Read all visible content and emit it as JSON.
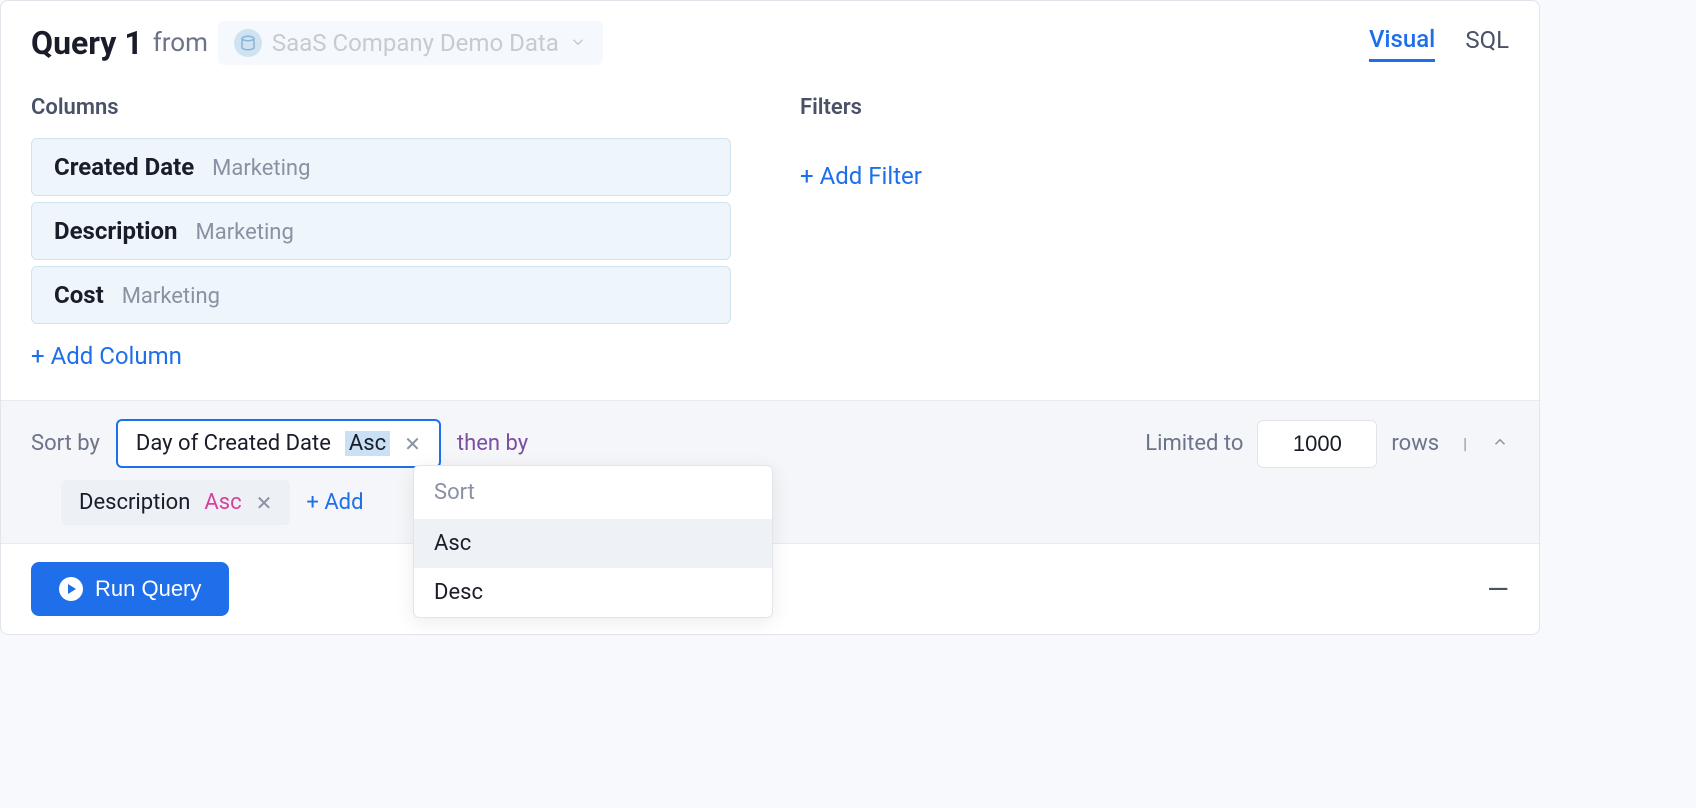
{
  "header": {
    "title": "Query 1",
    "from_label": "from",
    "connection_name": "SaaS Company Demo Data"
  },
  "tabs": {
    "visual": "Visual",
    "sql": "SQL"
  },
  "columns": {
    "section_title": "Columns",
    "items": [
      {
        "name": "Created Date",
        "source": "Marketing"
      },
      {
        "name": "Description",
        "source": "Marketing"
      },
      {
        "name": "Cost",
        "source": "Marketing"
      }
    ],
    "add_label": "+ Add Column"
  },
  "filters": {
    "section_title": "Filters",
    "add_label": "+ Add Filter"
  },
  "sort": {
    "label": "Sort by",
    "primary": {
      "field": "Day of Created Date",
      "direction": "Asc"
    },
    "then_by": "then by",
    "secondary": {
      "field": "Description",
      "direction": "Asc"
    },
    "add_label": "+ Add",
    "limited_to": "Limited to",
    "limit_value": "1000",
    "rows_label": "rows"
  },
  "dropdown": {
    "header": "Sort",
    "options": [
      "Asc",
      "Desc"
    ]
  },
  "footer": {
    "run_label": "Run Query"
  }
}
